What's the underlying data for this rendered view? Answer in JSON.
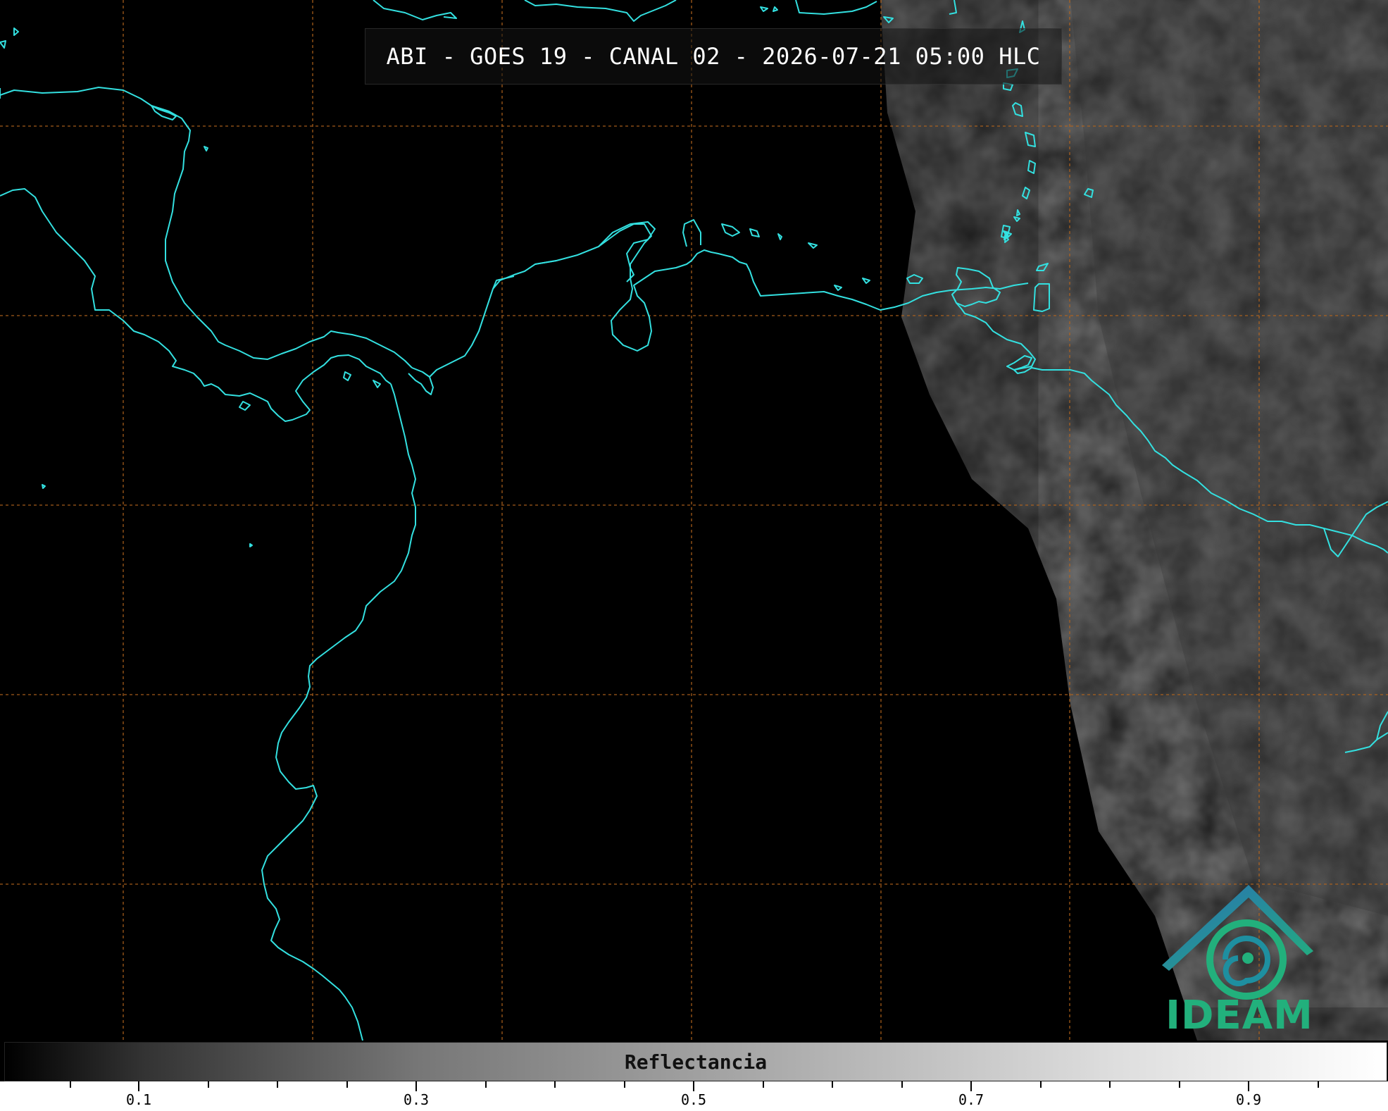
{
  "title": "ABI - GOES 19 - CANAL 02 - 2026-07-21 05:00 HLC",
  "logo": {
    "text": "IDEAM"
  },
  "colorbar": {
    "label": "Reflectancia",
    "ticks": [
      "0.1",
      "0.3",
      "0.5",
      "0.7",
      "0.9"
    ]
  },
  "colors": {
    "coastline": "#33e0e0",
    "grid": "#b5651d",
    "logo_green": "#22b07c",
    "logo_blue": "#2a6fb5"
  }
}
